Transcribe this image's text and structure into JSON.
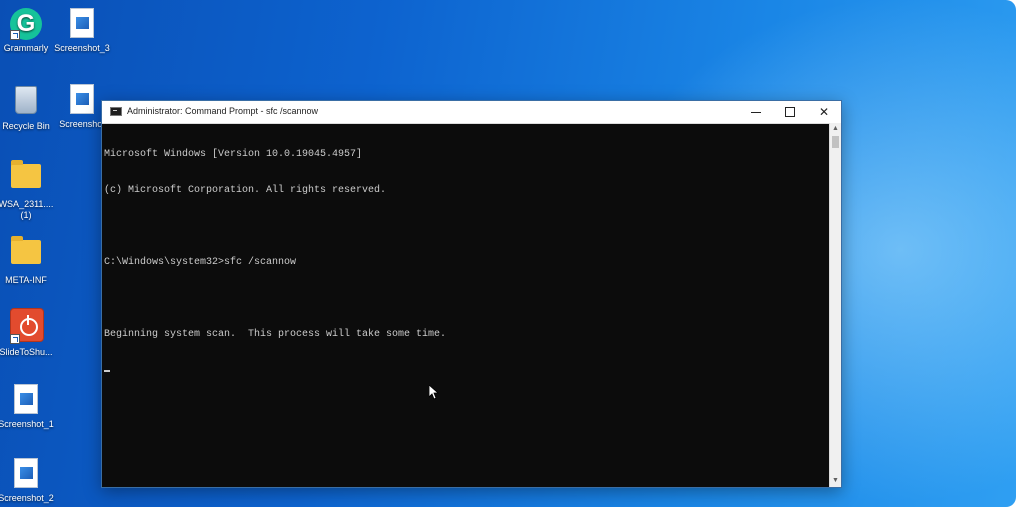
{
  "desktop": {
    "icons": [
      {
        "label": "Grammarly",
        "type": "grammarly",
        "glyph": "G"
      },
      {
        "label": "Screenshot_3",
        "type": "image"
      },
      {
        "label": "Recycle Bin",
        "type": "recycle-bin"
      },
      {
        "label": "Screenshot",
        "type": "image"
      },
      {
        "label": "WSA_2311....",
        "label2": "(1)",
        "type": "folder"
      },
      {
        "label": "META-INF",
        "type": "folder"
      },
      {
        "label": "SlideToShu...",
        "type": "power"
      },
      {
        "label": "Screenshot_1",
        "type": "image"
      },
      {
        "label": "Screenshot_2",
        "type": "image"
      }
    ]
  },
  "cmd": {
    "title": "Administrator: Command Prompt - sfc  /scannow",
    "lines": [
      "Microsoft Windows [Version 10.0.19045.4957]",
      "(c) Microsoft Corporation. All rights reserved.",
      "",
      "C:\\Windows\\system32>sfc /scannow",
      "",
      "Beginning system scan.  This process will take some time."
    ],
    "colors": {
      "background": "#0c0c0c",
      "text": "#cccccc"
    }
  },
  "colors": {
    "desktop_blue": "#0d63cf",
    "grammarly_green": "#15c39a",
    "power_red": "#e24b2e",
    "folder_yellow": "#f5c542"
  }
}
